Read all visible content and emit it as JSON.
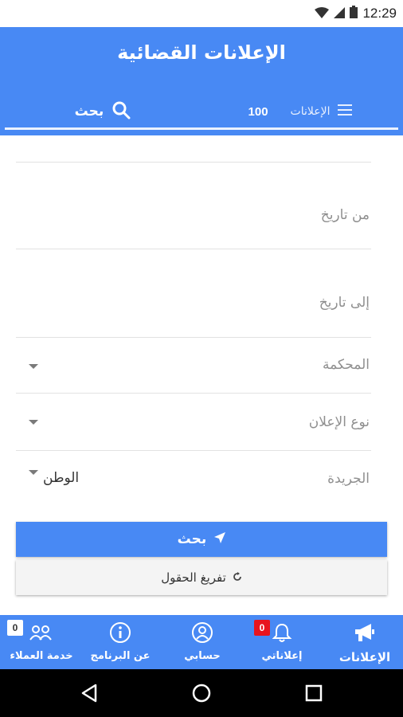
{
  "status_bar": {
    "time": "12:29"
  },
  "app_bar": {
    "title": "الإعلانات القضائية"
  },
  "tabs": {
    "search": {
      "label": "بحث"
    },
    "ads": {
      "label": "الإعلانات",
      "count": "100"
    }
  },
  "form": {
    "from_date": {
      "placeholder": "من تاريخ"
    },
    "to_date": {
      "placeholder": "إلى تاريخ"
    },
    "court": {
      "label": "المحكمة"
    },
    "ad_type": {
      "label": "نوع الإعلان"
    },
    "newspaper": {
      "label": "الجريدة",
      "value": "الوطن"
    },
    "search_button": "بحث",
    "clear_button": "تفريغ الحقول"
  },
  "bottom_nav": {
    "items": [
      {
        "label": "الإعلانات",
        "icon": "megaphone-icon",
        "active": true
      },
      {
        "label": "إعلاناتي",
        "icon": "bell-icon",
        "badge": "0"
      },
      {
        "label": "حسابي",
        "icon": "user-icon"
      },
      {
        "label": "عن البرنامج",
        "icon": "info-icon"
      },
      {
        "label": "خدمة العملاء",
        "icon": "customers-icon",
        "badge": "0"
      }
    ]
  },
  "colors": {
    "primary": "#4889f4",
    "badge_red": "#e8141e"
  }
}
